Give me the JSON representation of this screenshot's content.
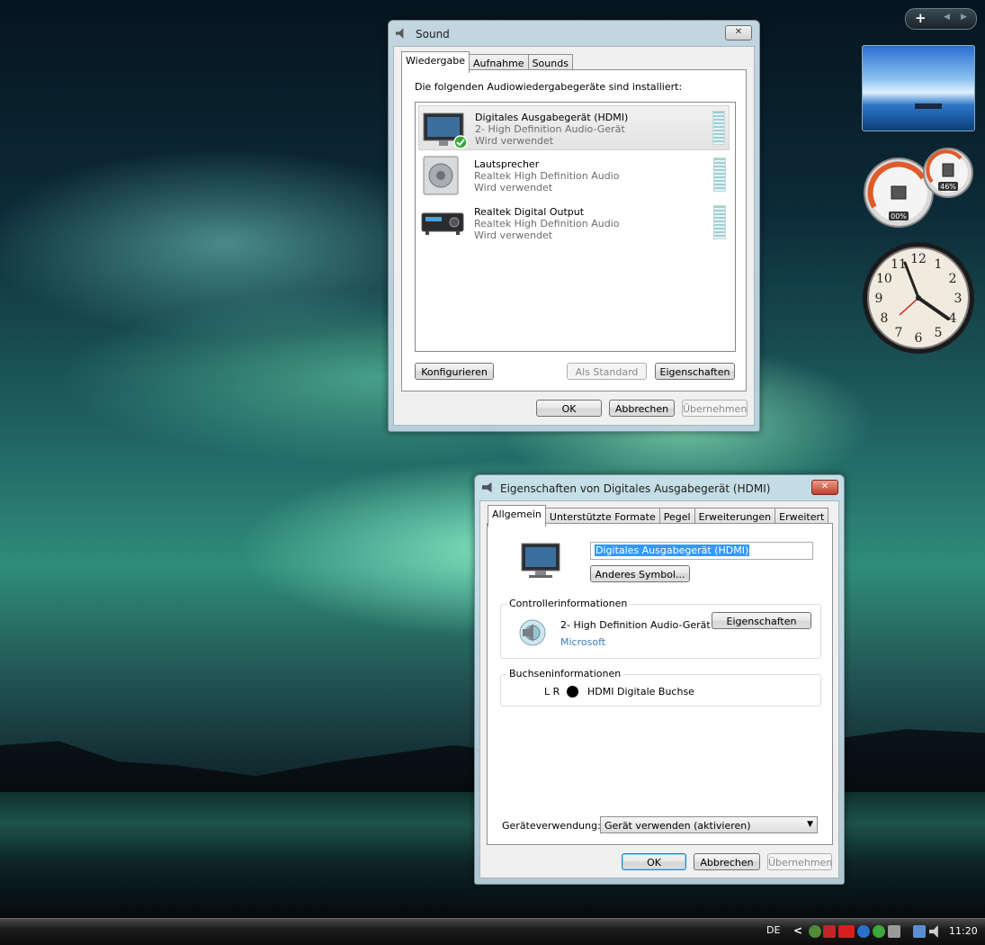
{
  "sound_window": {
    "title": "Sound",
    "tabs": [
      "Wiedergabe",
      "Aufnahme",
      "Sounds"
    ],
    "active_tab": "Wiedergabe",
    "heading": "Die folgenden Audiowiedergabegeräte sind installiert:",
    "devices": [
      {
        "name": "Digitales Ausgabegerät (HDMI)",
        "driver": "2- High Definition Audio-Gerät",
        "status": "Wird verwendet",
        "icon": "monitor-icon",
        "selected": true,
        "default": true
      },
      {
        "name": "Lautsprecher",
        "driver": "Realtek High Definition Audio",
        "status": "Wird verwendet",
        "icon": "speaker-icon",
        "selected": false
      },
      {
        "name": "Realtek Digital Output",
        "driver": "Realtek High Definition Audio",
        "status": "Wird verwendet",
        "icon": "receiver-icon",
        "selected": false
      }
    ],
    "buttons": {
      "configure": "Konfigurieren",
      "set_default": "Als Standard",
      "properties": "Eigenschaften",
      "ok": "OK",
      "cancel": "Abbrechen",
      "apply": "Übernehmen"
    }
  },
  "props_window": {
    "title": "Eigenschaften von Digitales Ausgabegerät (HDMI)",
    "tabs": [
      "Allgemein",
      "Unterstützte Formate",
      "Pegel",
      "Erweiterungen",
      "Erweitert"
    ],
    "active_tab": "Allgemein",
    "device_name_value": "Digitales Ausgabegerät (HDMI)",
    "change_icon_button": "Anderes Symbol...",
    "controller": {
      "legend": "Controllerinformationen",
      "name": "2- High Definition Audio-Gerät",
      "vendor": "Microsoft",
      "properties_button": "Eigenschaften"
    },
    "jack": {
      "legend": "Buchseninformationen",
      "channels": "L R",
      "name": "HDMI Digitale Buchse"
    },
    "usage_label": "Geräteverwendung:",
    "usage_value": "Gerät verwenden (aktivieren)",
    "buttons": {
      "ok": "OK",
      "cancel": "Abbrechen",
      "apply": "Übernehmen"
    }
  },
  "sidebar": {
    "add_button": "+",
    "prev": "◀",
    "next": "▶",
    "cpu_gauge_left": "00%",
    "cpu_gauge_right": "46%",
    "clock_numbers": [
      "12",
      "1",
      "2",
      "3",
      "4",
      "5",
      "6",
      "7",
      "8",
      "9",
      "10",
      "11"
    ]
  },
  "taskbar": {
    "language": "DE",
    "chevron": "<",
    "time": "11:20"
  }
}
